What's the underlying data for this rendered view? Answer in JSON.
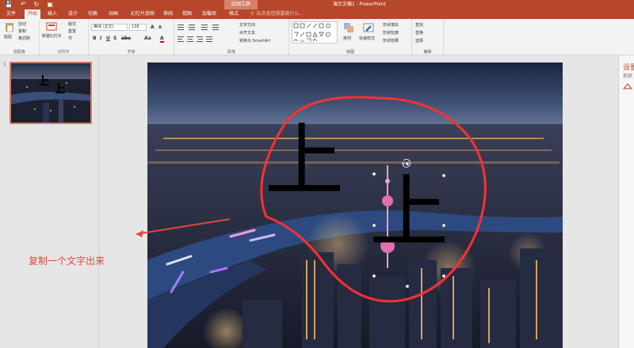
{
  "app": {
    "doc_title": "演示文稿1 - PowerPoint",
    "context_title": "绘图工具"
  },
  "qat": {
    "save_icon": "save-icon",
    "undo_icon": "undo-icon",
    "redo_icon": "redo-icon",
    "present_icon": "present-icon"
  },
  "tabs": [
    {
      "label": "文件"
    },
    {
      "label": "开始"
    },
    {
      "label": "插入"
    },
    {
      "label": "设计"
    },
    {
      "label": "切换"
    },
    {
      "label": "动画"
    },
    {
      "label": "幻灯片放映"
    },
    {
      "label": "审阅"
    },
    {
      "label": "视图"
    },
    {
      "label": "加载项"
    },
    {
      "label": "格式"
    }
  ],
  "tellme": {
    "placeholder": "告诉我您想要做什么..."
  },
  "ribbon": {
    "clipboard": {
      "paste": "粘贴",
      "cut": "剪切",
      "copy": "复制",
      "format_painter": "格式刷",
      "label": "剪贴板"
    },
    "slides": {
      "new_slide": "新建幻灯片",
      "layout": "版式",
      "reset": "重置",
      "section": "节",
      "label": "幻灯片"
    },
    "font": {
      "font_name": "等线 (正文)",
      "font_size": "138",
      "label": "字体"
    },
    "paragraph": {
      "text_direction": "文字方向",
      "align_text": "对齐文本",
      "smartart": "转换为 SmartArt",
      "label": "段落"
    },
    "drawing": {
      "arrange": "排列",
      "quick_styles": "快速样式",
      "fill": "形状填充",
      "outline": "形状轮廓",
      "effects": "形状效果",
      "label": "绘图"
    },
    "editing": {
      "find": "查找",
      "replace": "替换",
      "select": "选择",
      "label": "编辑"
    }
  },
  "slide_panel": {
    "slide_number": "1"
  },
  "slide": {
    "text_1": "上",
    "text_2": "上"
  },
  "right_panel": {
    "title": "设置",
    "subtitle": "形状"
  },
  "annotation": {
    "text": "复制一个文字出来"
  },
  "colors": {
    "accent": "#b7472a",
    "annotation": "#e2463a"
  }
}
